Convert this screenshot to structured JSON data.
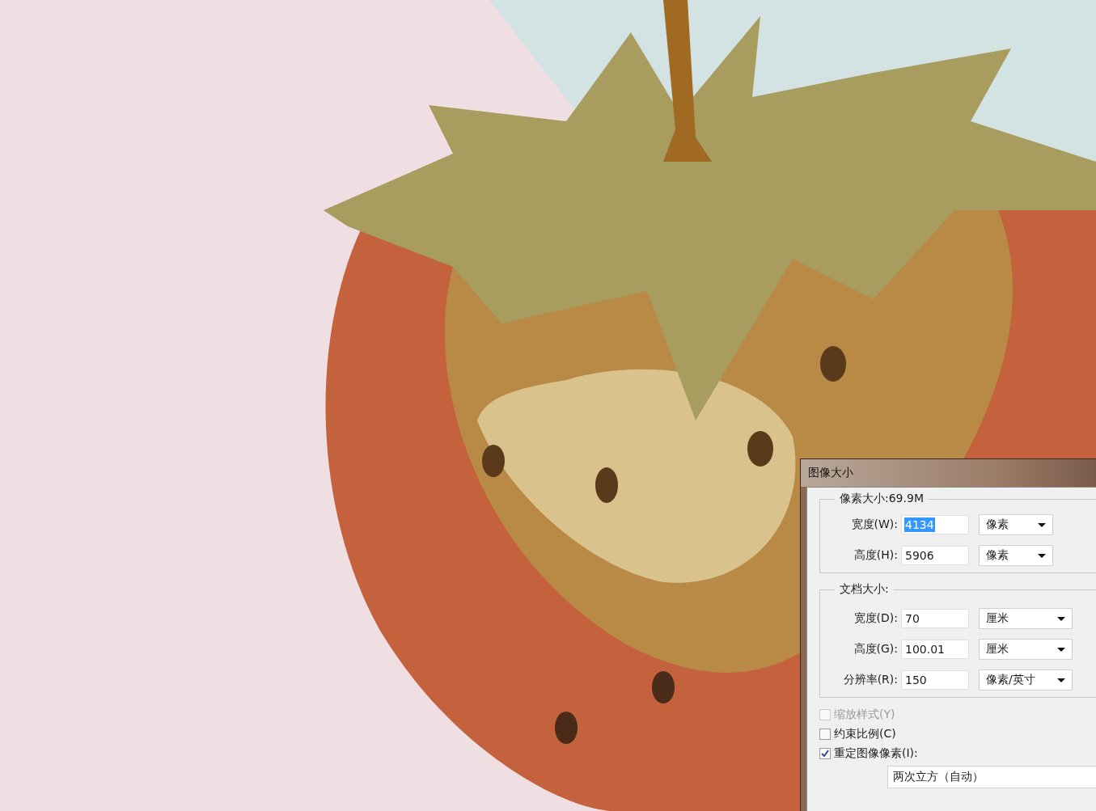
{
  "dialog": {
    "title": "图像大小",
    "pixel_size": {
      "legend": "像素大小:69.9M",
      "rows": [
        {
          "label": "宽度(W):",
          "value": "4134",
          "selected": true,
          "unit": "像素"
        },
        {
          "label": "高度(H):",
          "value": "5906",
          "selected": false,
          "unit": "像素"
        }
      ]
    },
    "document_size": {
      "legend": "文档大小:",
      "rows": [
        {
          "label": "宽度(D):",
          "value": "70",
          "selected": false,
          "unit": "厘米"
        },
        {
          "label": "高度(G):",
          "value": "100.01",
          "selected": false,
          "unit": "厘米"
        },
        {
          "label": "分辨率(R):",
          "value": "150",
          "selected": false,
          "unit": "像素/英寸"
        }
      ]
    },
    "options": [
      {
        "label": "缩放样式(Y)",
        "checked": false,
        "disabled": true
      },
      {
        "label": "约束比例(C)",
        "checked": false,
        "disabled": false
      },
      {
        "label": "重定图像像素(I):",
        "checked": true,
        "disabled": false
      }
    ],
    "resample_method": "两次立方（自动）"
  }
}
